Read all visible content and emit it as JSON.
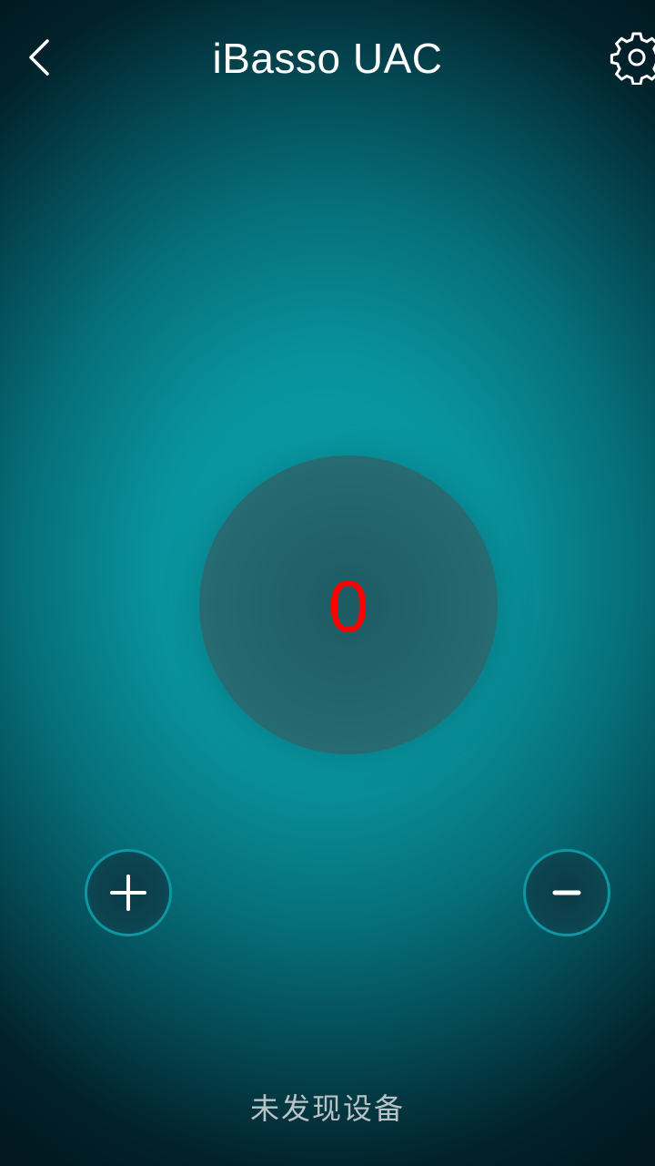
{
  "header": {
    "title": "iBasso UAC",
    "back_icon": "chevron-left-icon",
    "settings_icon": "gear-icon"
  },
  "volume": {
    "value": "0",
    "value_color": "#ff0000"
  },
  "controls": {
    "increase_icon": "plus-icon",
    "decrease_icon": "minus-icon"
  },
  "status": {
    "text": "未发现设备"
  },
  "colors": {
    "background_center": "#0aa3ad",
    "background_edge": "#011820",
    "button_ring": "#0d97a1",
    "text_primary": "#ffffff",
    "text_status": "#b9c3c6"
  }
}
